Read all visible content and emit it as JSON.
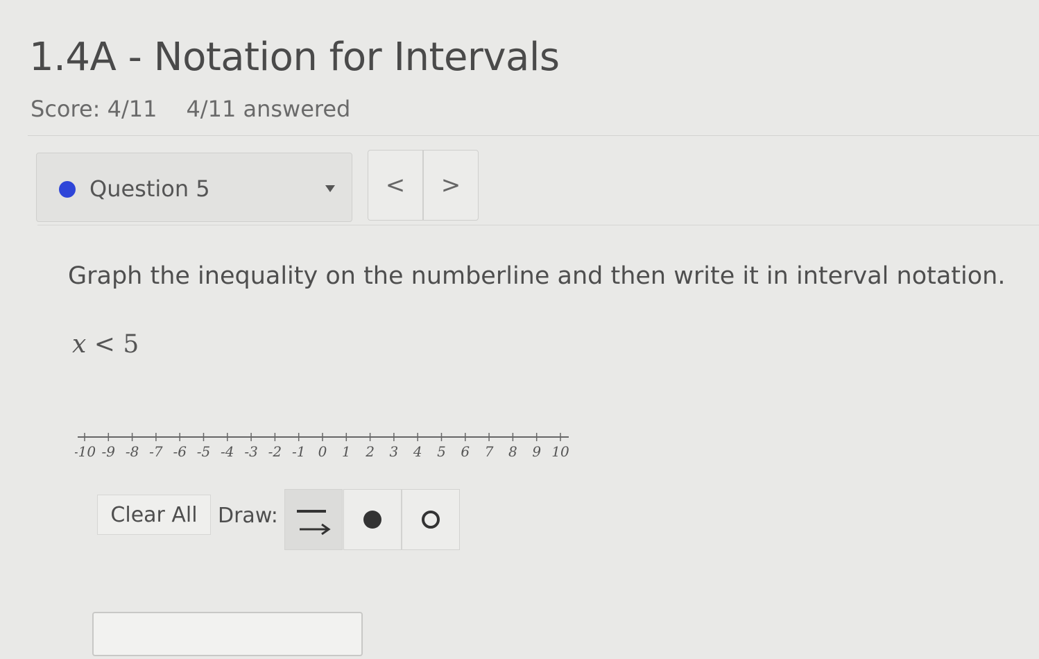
{
  "header": {
    "title": "1.4A - Notation for Intervals",
    "score": "Score: 4/11",
    "answered": "4/11 answered"
  },
  "question_nav": {
    "current": "Question 5",
    "prev_label": "<",
    "next_label": ">",
    "status_color": "#2e45d8"
  },
  "problem": {
    "instruction": "Graph the inequality on the numberline and then write it in interval notation.",
    "inequality_var": "x",
    "inequality_op": " < ",
    "inequality_value": "5"
  },
  "numberline": {
    "min": -10,
    "max": 10,
    "tick_labels": [
      "-10",
      "-9",
      "-8",
      "-7",
      "-6",
      "-5",
      "-4",
      "-3",
      "-2",
      "-1",
      "0",
      "1",
      "2",
      "3",
      "4",
      "5",
      "6",
      "7",
      "8",
      "9",
      "10"
    ]
  },
  "toolbar": {
    "clear_label": "Clear All",
    "draw_label": "Draw:",
    "tools": [
      "ray-tool-icon",
      "closed-dot-icon",
      "open-dot-icon"
    ]
  },
  "answer": {
    "value": ""
  }
}
